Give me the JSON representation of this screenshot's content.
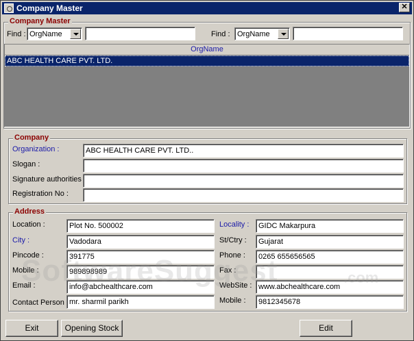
{
  "window": {
    "title": "Company Master"
  },
  "master_group": {
    "title": "Company Master"
  },
  "find_left": {
    "label": "Find :",
    "combo_value": "OrgName",
    "text": ""
  },
  "find_right": {
    "label": "Find :",
    "combo_value": "OrgName",
    "text": ""
  },
  "grid": {
    "header": "OrgName",
    "rows": [
      "ABC HEALTH CARE PVT. LTD."
    ]
  },
  "company_group": {
    "title": "Company",
    "organization_label": "Organization :",
    "organization": "ABC HEALTH CARE PVT. LTD..",
    "slogan_label": "Slogan :",
    "slogan": "",
    "signature_label": "Signature authorities :",
    "signature": "",
    "registration_label": "Registration  No :",
    "registration": ""
  },
  "address_group": {
    "title": "Address",
    "location_label": "Location :",
    "location": "Plot No. 500002",
    "city_label": "City :",
    "city": "Vadodara",
    "pincode_label": "Pincode :",
    "pincode": "391775",
    "mobile_label": "Mobile :",
    "mobile": "989898989",
    "email_label": "Email :",
    "email": "info@abchealthcare.com",
    "contact_label": "Contact Person :",
    "contact": "mr. sharmil parikh",
    "locality_label": "Locality :",
    "locality": "GIDC Makarpura",
    "state_label": "St/Ctry :",
    "state": "Gujarat",
    "phone_label": "Phone :",
    "phone": "0265 655656565",
    "fax_label": "Fax :",
    "fax": "",
    "website_label": "WebSite :",
    "website": "www.abchealthcare.com",
    "mobile2_label": "Mobile :",
    "mobile2": "9812345678"
  },
  "buttons": {
    "exit": "Exit",
    "opening_stock": "Opening Stock",
    "edit": "Edit"
  },
  "watermark": {
    "main": "SoftwareSuggest",
    "suffix": ".com"
  }
}
